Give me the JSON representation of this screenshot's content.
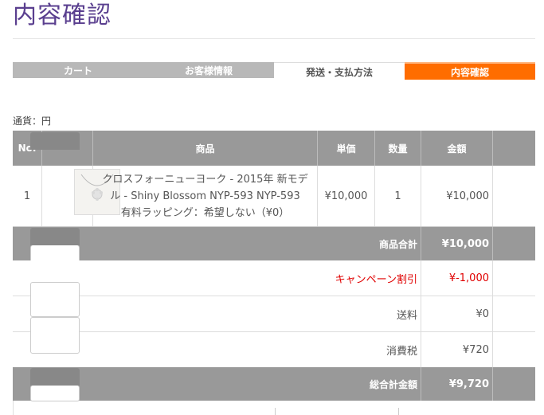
{
  "page": {
    "title": "内容確認"
  },
  "steps": [
    {
      "label": "カート"
    },
    {
      "label": "お客様情報"
    },
    {
      "label": "発送・支払方法"
    },
    {
      "label": "内容確認"
    }
  ],
  "currency": "通貨：円",
  "table": {
    "headers": {
      "no": "No.",
      "product": "商品",
      "unit_price": "単価",
      "qty": "数量",
      "amount": "金額"
    },
    "items": [
      {
        "no": "1",
        "name_line1": "クロスフォーニューヨーク - 2015年 新モデ",
        "name_line2": "ル - Shiny Blossom NYP-593 NYP-593",
        "option": "有料ラッピング：希望しない（¥0）",
        "unit_price": "¥10,000",
        "qty": "1",
        "amount": "¥10,000"
      }
    ],
    "subtotal": {
      "label": "商品合計",
      "value": "¥10,000"
    },
    "campaign": {
      "label": "キャンペーン割引",
      "value": "¥-1,000"
    },
    "shipping": {
      "label": "送料",
      "value": "¥0"
    },
    "tax": {
      "label": "消費税",
      "value": "¥720"
    },
    "total": {
      "label": "総合計金額",
      "value": "¥9,720"
    }
  },
  "colors": {
    "accent": "#ff6d00",
    "header_gray": "#999999",
    "title": "#5a3f8f",
    "discount": "#e00000"
  }
}
